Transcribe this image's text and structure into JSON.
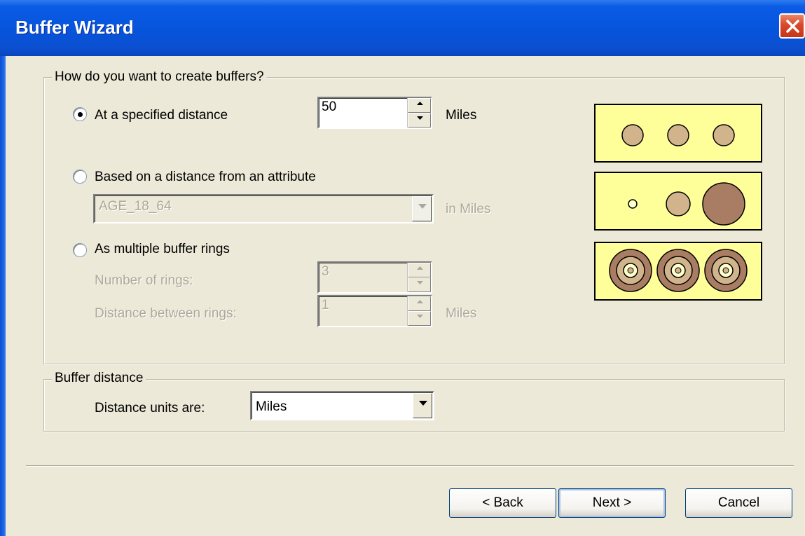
{
  "window": {
    "title": "Buffer Wizard"
  },
  "create_group": {
    "legend": "How do you want to create buffers?",
    "options": [
      {
        "label": "At a specified distance",
        "selected": true
      },
      {
        "label": "Based on a distance from an attribute",
        "selected": false
      },
      {
        "label": "As multiple buffer rings",
        "selected": false
      }
    ],
    "specified_distance": {
      "value": "50",
      "unit": "Miles"
    },
    "attribute": {
      "value": "AGE_18_64",
      "unit": "in Miles"
    },
    "rings": {
      "number_label": "Number of rings:",
      "number_value": "3",
      "distance_label": "Distance between rings:",
      "distance_value": "1",
      "distance_unit": "Miles"
    }
  },
  "distance_group": {
    "legend": "Buffer distance",
    "units_label": "Distance units are:",
    "units_value": "Miles"
  },
  "buttons": {
    "back": "< Back",
    "next": "Next >",
    "cancel": "Cancel"
  },
  "colors": {
    "title_bar": "#0754dc",
    "dialog_bg": "#ece9d8",
    "illustration_bg": "#ffff99",
    "circle_fill": "#d2b48c",
    "circle_dark": "#a97d63"
  },
  "icons": {
    "close": "close-icon",
    "spin_up": "spin-up-arrow-icon",
    "spin_down": "spin-down-arrow-icon",
    "dropdown": "dropdown-arrow-icon"
  }
}
